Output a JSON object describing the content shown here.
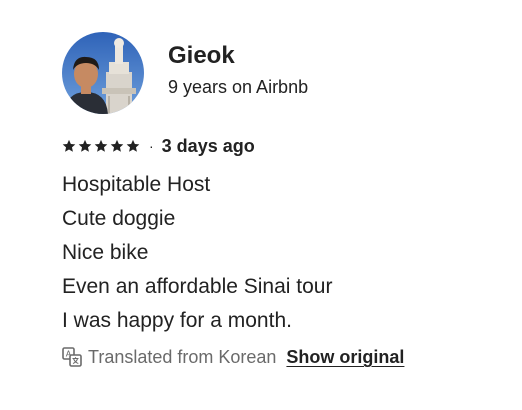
{
  "reviewer": {
    "name": "Gieok",
    "tenure": "9 years on Airbnb",
    "avatar_icon": "reviewer-avatar-photo"
  },
  "review": {
    "rating": 5,
    "rating_max": 5,
    "separator": "·",
    "date": "3 days ago",
    "lines": [
      "Hospitable Host",
      "Cute doggie",
      "Nice bike",
      "Even an affordable Sinai tour",
      "I was happy for a month."
    ]
  },
  "translation": {
    "icon": "translate-icon",
    "text": "Translated from Korean",
    "show_original_label": "Show original"
  },
  "colors": {
    "text": "#222222",
    "muted": "#6a6a6a"
  }
}
